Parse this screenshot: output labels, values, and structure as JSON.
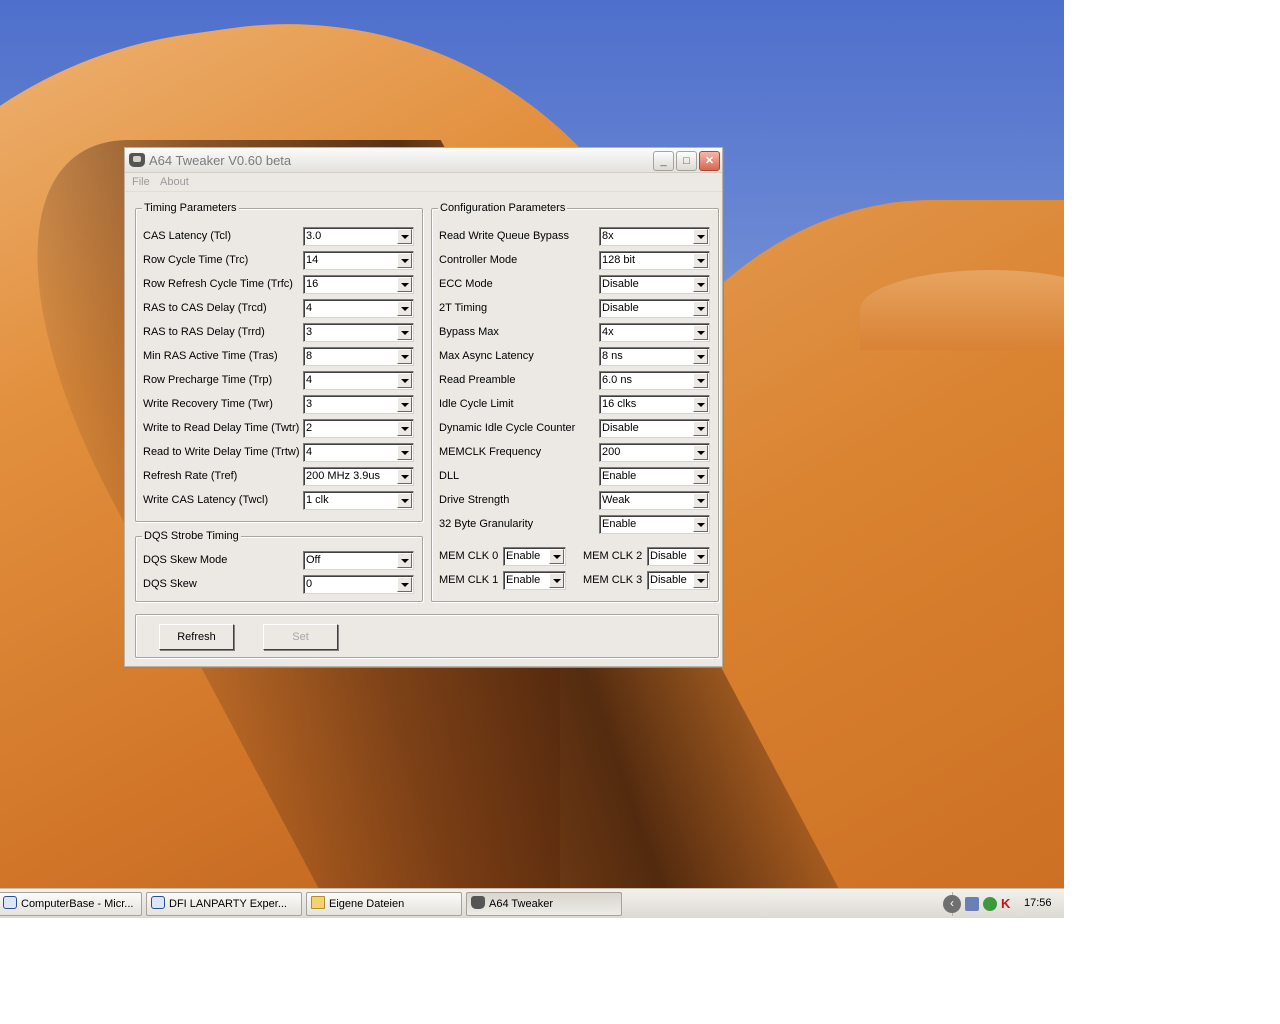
{
  "window": {
    "title": "A64 Tweaker V0.60 beta",
    "menu": [
      "File",
      "About"
    ]
  },
  "timing": {
    "title": "Timing Parameters",
    "rows": [
      {
        "label": "CAS Latency (Tcl)",
        "value": "3.0"
      },
      {
        "label": "Row Cycle Time (Trc)",
        "value": "14"
      },
      {
        "label": "Row Refresh Cycle Time (Trfc)",
        "value": "16"
      },
      {
        "label": "RAS to CAS Delay (Trcd)",
        "value": "4"
      },
      {
        "label": "RAS to RAS Delay (Trrd)",
        "value": "3"
      },
      {
        "label": "Min RAS Active Time (Tras)",
        "value": "8"
      },
      {
        "label": "Row Precharge Time (Trp)",
        "value": "4"
      },
      {
        "label": "Write Recovery Time (Twr)",
        "value": "3"
      },
      {
        "label": "Write to Read Delay Time (Twtr)",
        "value": "2"
      },
      {
        "label": "Read to Write Delay Time (Trtw)",
        "value": "4"
      },
      {
        "label": "Refresh Rate (Tref)",
        "value": "200 MHz 3.9us"
      },
      {
        "label": "Write CAS Latency (Twcl)",
        "value": "1 clk"
      }
    ]
  },
  "dqs": {
    "title": "DQS Strobe Timing",
    "rows": [
      {
        "label": "DQS Skew Mode",
        "value": "Off"
      },
      {
        "label": "DQS Skew",
        "value": "0"
      }
    ]
  },
  "config": {
    "title": "Configuration Parameters",
    "rows": [
      {
        "label": "Read Write Queue Bypass",
        "value": "8x"
      },
      {
        "label": "Controller Mode",
        "value": "128 bit"
      },
      {
        "label": "ECC Mode",
        "value": "Disable"
      },
      {
        "label": "2T Timing",
        "value": "Disable"
      },
      {
        "label": "Bypass Max",
        "value": "4x"
      },
      {
        "label": "Max Async Latency",
        "value": "8 ns"
      },
      {
        "label": "Read Preamble",
        "value": "6.0 ns"
      },
      {
        "label": "Idle Cycle Limit",
        "value": "16 clks"
      },
      {
        "label": "Dynamic Idle Cycle Counter",
        "value": "Disable"
      },
      {
        "label": "MEMCLK Frequency",
        "value": "200"
      },
      {
        "label": "DLL",
        "value": "Enable"
      },
      {
        "label": "Drive Strength",
        "value": "Weak"
      },
      {
        "label": "32 Byte Granularity",
        "value": "Enable"
      }
    ],
    "memclk": [
      {
        "label": "MEM CLK 0",
        "value": "Enable"
      },
      {
        "label": "MEM CLK 1",
        "value": "Enable"
      },
      {
        "label": "MEM CLK 2",
        "value": "Disable"
      },
      {
        "label": "MEM CLK 3",
        "value": "Disable"
      }
    ]
  },
  "buttons": {
    "refresh": "Refresh",
    "set": "Set"
  },
  "taskbar": {
    "tasks": [
      "ComputerBase - Micr...",
      "DFI LANPARTY Exper...",
      "Eigene Dateien",
      "A64 Tweaker"
    ],
    "clock": "17:56"
  },
  "colors": {
    "window_bg": "#ece9e4",
    "disabled_text": "#a6a6a6"
  }
}
